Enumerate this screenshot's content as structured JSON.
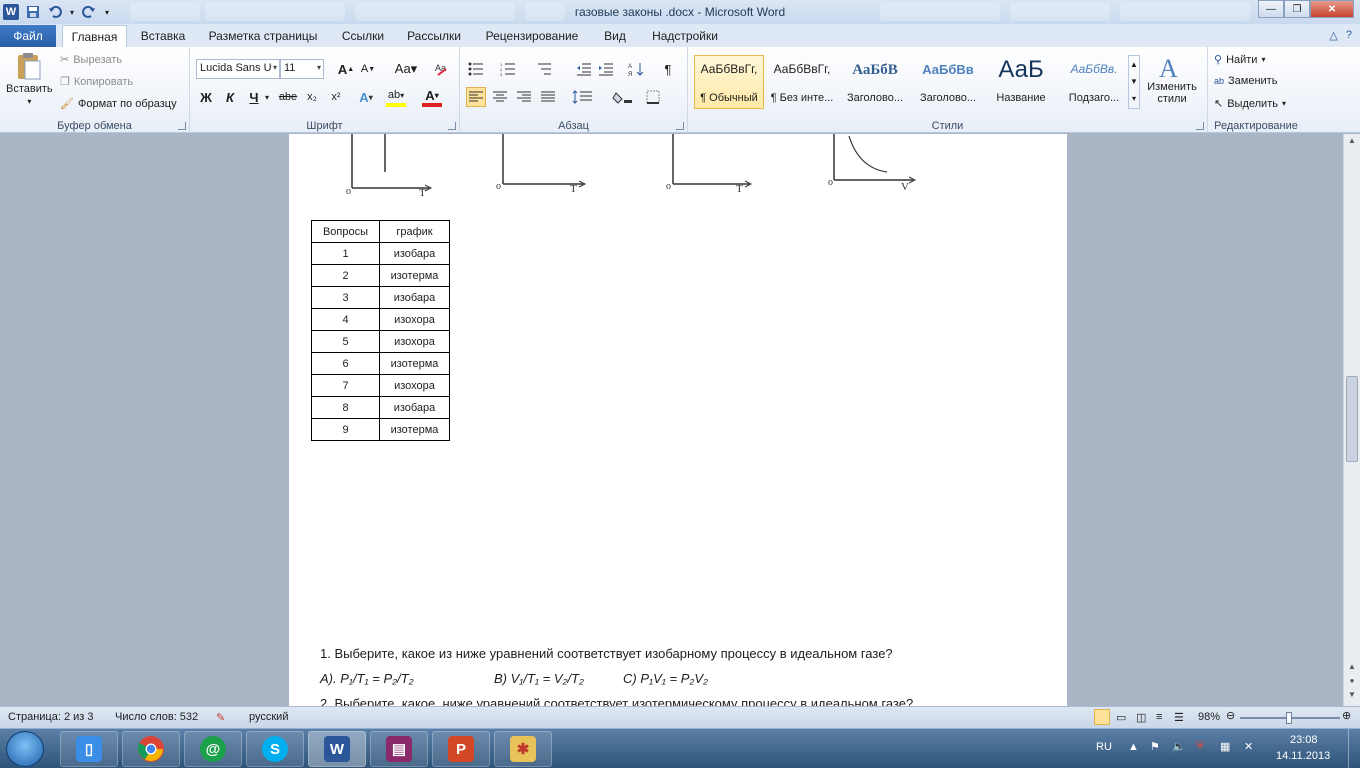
{
  "window": {
    "title": "газовые законы .docx - Microsoft Word",
    "controls": [
      "minimize",
      "maximize",
      "close"
    ]
  },
  "tabs": {
    "file": "Файл",
    "items": [
      "Главная",
      "Вставка",
      "Разметка страницы",
      "Ссылки",
      "Рассылки",
      "Рецензирование",
      "Вид",
      "Надстройки"
    ],
    "active": "Главная"
  },
  "clipboard": {
    "paste": "Вставить",
    "cut": "Вырезать",
    "copy": "Копировать",
    "format_painter": "Формат по образцу",
    "group_label": "Буфер обмена"
  },
  "font": {
    "name": "Lucida Sans U",
    "size": "11",
    "group_label": "Шрифт",
    "buttons": [
      "Ж",
      "К",
      "Ч",
      "abe",
      "x₂",
      "x²",
      "A",
      "ab",
      "A"
    ]
  },
  "paragraph": {
    "group_label": "Абзац",
    "pilcrow": "¶"
  },
  "styles": {
    "group_label": "Стили",
    "items": [
      {
        "sample": "АаБбВвГг,",
        "name": "¶ Обычный"
      },
      {
        "sample": "АаБбВвГг,",
        "name": "¶ Без инте..."
      },
      {
        "sample": "АаБбВ",
        "name": "Заголово..."
      },
      {
        "sample": "АаБбВв",
        "name": "Заголово..."
      },
      {
        "sample": "АаБ",
        "name": "Название"
      },
      {
        "sample": "АаБбВв.",
        "name": "Подзаго..."
      }
    ],
    "change_styles": "Изменить стили"
  },
  "editing": {
    "group_label": "Редактирование",
    "find": "Найти",
    "replace": "Заменить",
    "select": "Выделить"
  },
  "document": {
    "graph_axes": [
      "T",
      "T",
      "T",
      "V"
    ],
    "graph_origin": "o",
    "table": {
      "headers": [
        "Вопросы",
        "график"
      ],
      "rows": [
        [
          "1",
          "изобара"
        ],
        [
          "2",
          "изотерма"
        ],
        [
          "3",
          "изобара"
        ],
        [
          "4",
          "изохора"
        ],
        [
          "5",
          "изохора"
        ],
        [
          "6",
          "изотерма"
        ],
        [
          "7",
          "изохора"
        ],
        [
          "8",
          "изобара"
        ],
        [
          "9",
          "изотерма"
        ]
      ]
    },
    "question1": "1. Выберите, какое из ниже уравнений соответствует изобарному процессу в идеальном газе?",
    "options1": [
      "A). P₁/T₁ = P₂/T₂",
      "B) V₁/T₁ = V₂/T₂",
      "C) P₁V₁ = P₂V₂"
    ],
    "question2": "2. Выберите, какое, ниже уравнений соответствует изотермическому процессу в идеальном газе?"
  },
  "statusbar": {
    "page": "Страница: 2 из 3",
    "words": "Число слов: 532",
    "language": "русский",
    "zoom": "98%",
    "zoom_level_percent": 98
  },
  "taskbar": {
    "apps": [
      "explorer",
      "chrome",
      "mail-agent",
      "skype",
      "word",
      "winrar",
      "powerpoint",
      "paint"
    ],
    "lang": "RU",
    "time": "23:08",
    "date": "14.11.2013"
  }
}
